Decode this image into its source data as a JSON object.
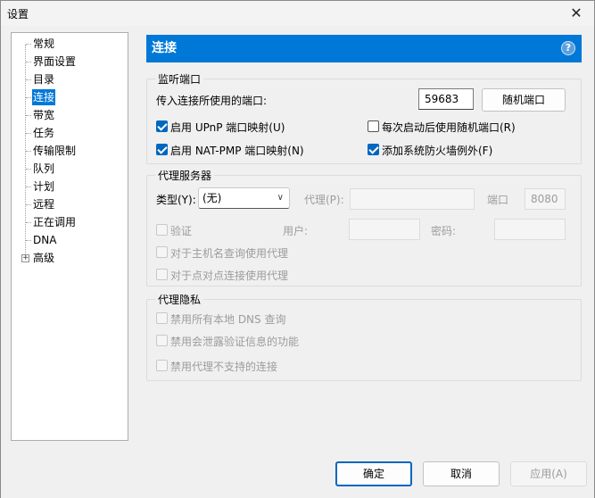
{
  "window": {
    "title": "设置"
  },
  "tree": {
    "items": [
      {
        "label": "常规"
      },
      {
        "label": "界面设置"
      },
      {
        "label": "目录"
      },
      {
        "label": "连接"
      },
      {
        "label": "带宽"
      },
      {
        "label": "任务"
      },
      {
        "label": "传输限制"
      },
      {
        "label": "队列"
      },
      {
        "label": "计划"
      },
      {
        "label": "远程"
      },
      {
        "label": "正在调用"
      },
      {
        "label": "DNA"
      },
      {
        "label": "高级"
      }
    ],
    "selected_index": 3
  },
  "header": {
    "title": "连接",
    "help_glyph": "?"
  },
  "listen": {
    "title": "监听端口",
    "port_label": "传入连接所使用的端口:",
    "port_value": "59683",
    "random_button": "随机端口",
    "upnp_label": "启用 UPnP 端口映射(U)",
    "upnp_checked": true,
    "natpmp_label": "启用 NAT-PMP 端口映射(N)",
    "natpmp_checked": true,
    "random_each_start_label": "每次启动后使用随机端口(R)",
    "random_each_start_checked": false,
    "firewall_label": "添加系统防火墙例外(F)",
    "firewall_checked": true
  },
  "proxy": {
    "title": "代理服务器",
    "type_label": "类型(Y):",
    "type_value": "(无)",
    "proxy_label": "代理(P):",
    "proxy_value": "",
    "port_label": "端口",
    "port_value": "8080",
    "auth_label": "验证",
    "user_label": "用户:",
    "user_value": "",
    "password_label": "密码:",
    "password_value": "",
    "hostname_label": "对于主机名查询使用代理",
    "p2p_label": "对于点对点连接使用代理"
  },
  "privacy": {
    "title": "代理隐私",
    "disable_dns_label": "禁用所有本地 DNS 查询",
    "disable_leak_label": "禁用会泄露验证信息的功能",
    "disable_unsupported_label": "禁用代理不支持的连接"
  },
  "footer": {
    "ok": "确定",
    "cancel": "取消",
    "apply": "应用(A)"
  },
  "colors": {
    "accent": "#0078d7",
    "selected": "#0078d7"
  }
}
